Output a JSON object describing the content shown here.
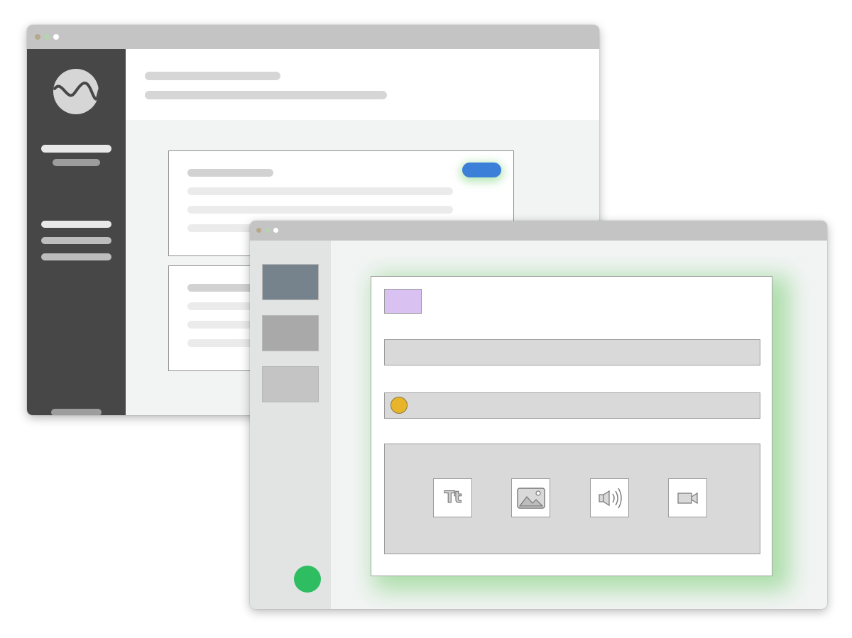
{
  "colors": {
    "titlebar": "#c4c4c4",
    "back_sidebar": "#474747",
    "primary_button": "#3b7fd9",
    "glow": "#a9e3a5",
    "tag": "#d9c2f2",
    "status_dot": "#e8b52a",
    "fab": "#2fbd62",
    "thumb_selected": "#76828c",
    "thumb": "#a9a9a9",
    "thumb_light": "#c4c4c4"
  },
  "back_window": {
    "traffic_lights": [
      "#b6a98a",
      "#b4d3b0",
      "#ffffff"
    ],
    "sidebar_nav_items": 3,
    "cards": 2,
    "primary_action": "blue-pill-button"
  },
  "front_window": {
    "traffic_lights": [
      "#b6a98a",
      "#b4d3b0",
      "#ffffff"
    ],
    "thumbnails": 3,
    "toolbar": [
      "text-icon",
      "image-icon",
      "audio-icon",
      "video-icon"
    ],
    "text_tool_glyph": "Tt"
  }
}
